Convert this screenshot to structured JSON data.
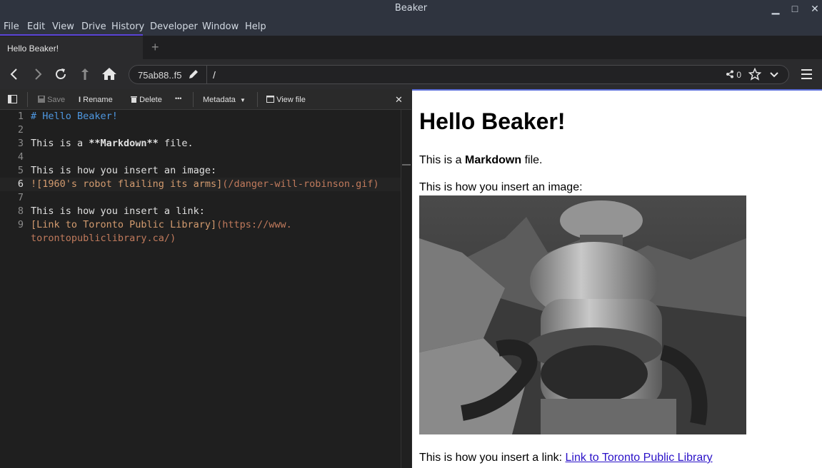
{
  "window": {
    "title": "Beaker",
    "minimize": "▁",
    "maximize": "□",
    "close": "✕"
  },
  "menu": {
    "file": "File",
    "edit": "Edit",
    "view": "View",
    "drive": "Drive",
    "history": "History",
    "developer": "Developer",
    "window": "Window",
    "help": "Help"
  },
  "tabs": {
    "active": "Hello Beaker!",
    "new": "+"
  },
  "urlbar": {
    "origin": "75ab88..f5",
    "path": "/",
    "share_count": "0"
  },
  "editor_toolbar": {
    "save": "Save",
    "rename": "Rename",
    "delete": "Delete",
    "more": "•••",
    "metadata": "Metadata",
    "view_file": "View file",
    "close": "✕"
  },
  "editor": {
    "line_numbers": [
      "1",
      "2",
      "3",
      "4",
      "5",
      "6",
      "7",
      "8",
      "9"
    ],
    "l1": "# Hello Beaker!",
    "l3_a": "This is a ",
    "l3_b": "**Markdown**",
    "l3_c": " file.",
    "l5": "This is how you insert an image:",
    "l6_a": "![1960's robot flailing its arms]",
    "l6_b": "(/danger-will-robinson.gif)",
    "l8": "This is how you insert a link:",
    "l9_a": "[Link to Toronto Public Library]",
    "l9_b": "(https://www.",
    "l9_c": "torontopubliclibrary.ca/)"
  },
  "preview": {
    "heading": "Hello Beaker!",
    "p1_a": "This is a ",
    "p1_b": "Markdown",
    "p1_c": " file.",
    "p2": "This is how you insert an image:",
    "p3": "This is how you insert a link: ",
    "link": "Link to Toronto Public Library"
  }
}
